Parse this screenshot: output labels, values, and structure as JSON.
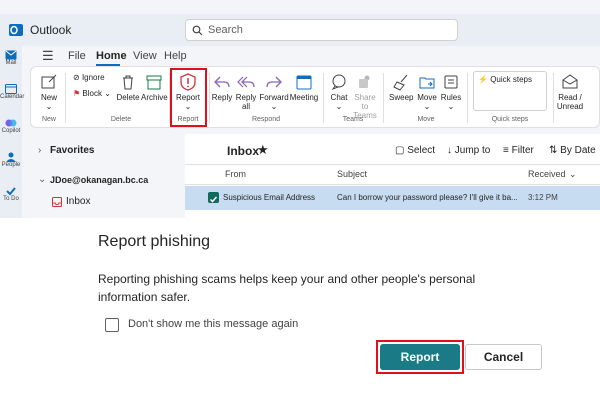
{
  "app": {
    "title": "Outlook"
  },
  "search": {
    "placeholder": "Search"
  },
  "rail": [
    "Mail",
    "Calendar",
    "Copilot",
    "People",
    "To Do"
  ],
  "menu": {
    "items": [
      "File",
      "Home",
      "View",
      "Help"
    ],
    "active": "Home"
  },
  "ribbon": {
    "new": {
      "label": "New",
      "group": "New"
    },
    "ignore": "Ignore",
    "block": "Block",
    "delete": "Delete",
    "archive": "Archive",
    "delete_group": "Delete",
    "report": {
      "label": "Report",
      "group": "Report"
    },
    "reply": "Reply",
    "reply_all_1": "Reply",
    "reply_all_2": "all",
    "forward": "Forward",
    "meeting": "Meeting",
    "respond_group": "Respond",
    "chat": "Chat",
    "share_teams_1": "Share to",
    "share_teams_2": "Teams",
    "teams_group": "Teams",
    "sweep": "Sweep",
    "move": "Move",
    "rules": "Rules",
    "move_group": "Move",
    "quick_steps": "Quick steps",
    "quick_group": "Quick steps",
    "read_unread_1": "Read /",
    "read_unread_2": "Unread"
  },
  "folders": {
    "favorites": "Favorites",
    "account": "JDoe@okanagan.bc.ca",
    "inbox": "Inbox"
  },
  "mail": {
    "heading": "Inbox",
    "tools": {
      "select": "Select",
      "jump": "Jump to",
      "filter": "Filter",
      "sort": "By Date"
    },
    "columns": {
      "from": "From",
      "subject": "Subject",
      "received": "Received"
    },
    "row": {
      "from": "Suspicious Email Address",
      "subject": "Can I borrow your password please? I'll give it ba...",
      "time": "3:12 PM"
    }
  },
  "dialog": {
    "title": "Report phishing",
    "body": "Reporting phishing scams helps keep your and other people's personal information safer.",
    "checkbox_label": "Don't show me this message again",
    "report_button": "Report",
    "cancel_button": "Cancel"
  },
  "colors": {
    "accent": "#0f6cbd",
    "report_button": "#1a7a86",
    "highlight": "#e0101a",
    "selected_row": "#c7dcf0"
  }
}
